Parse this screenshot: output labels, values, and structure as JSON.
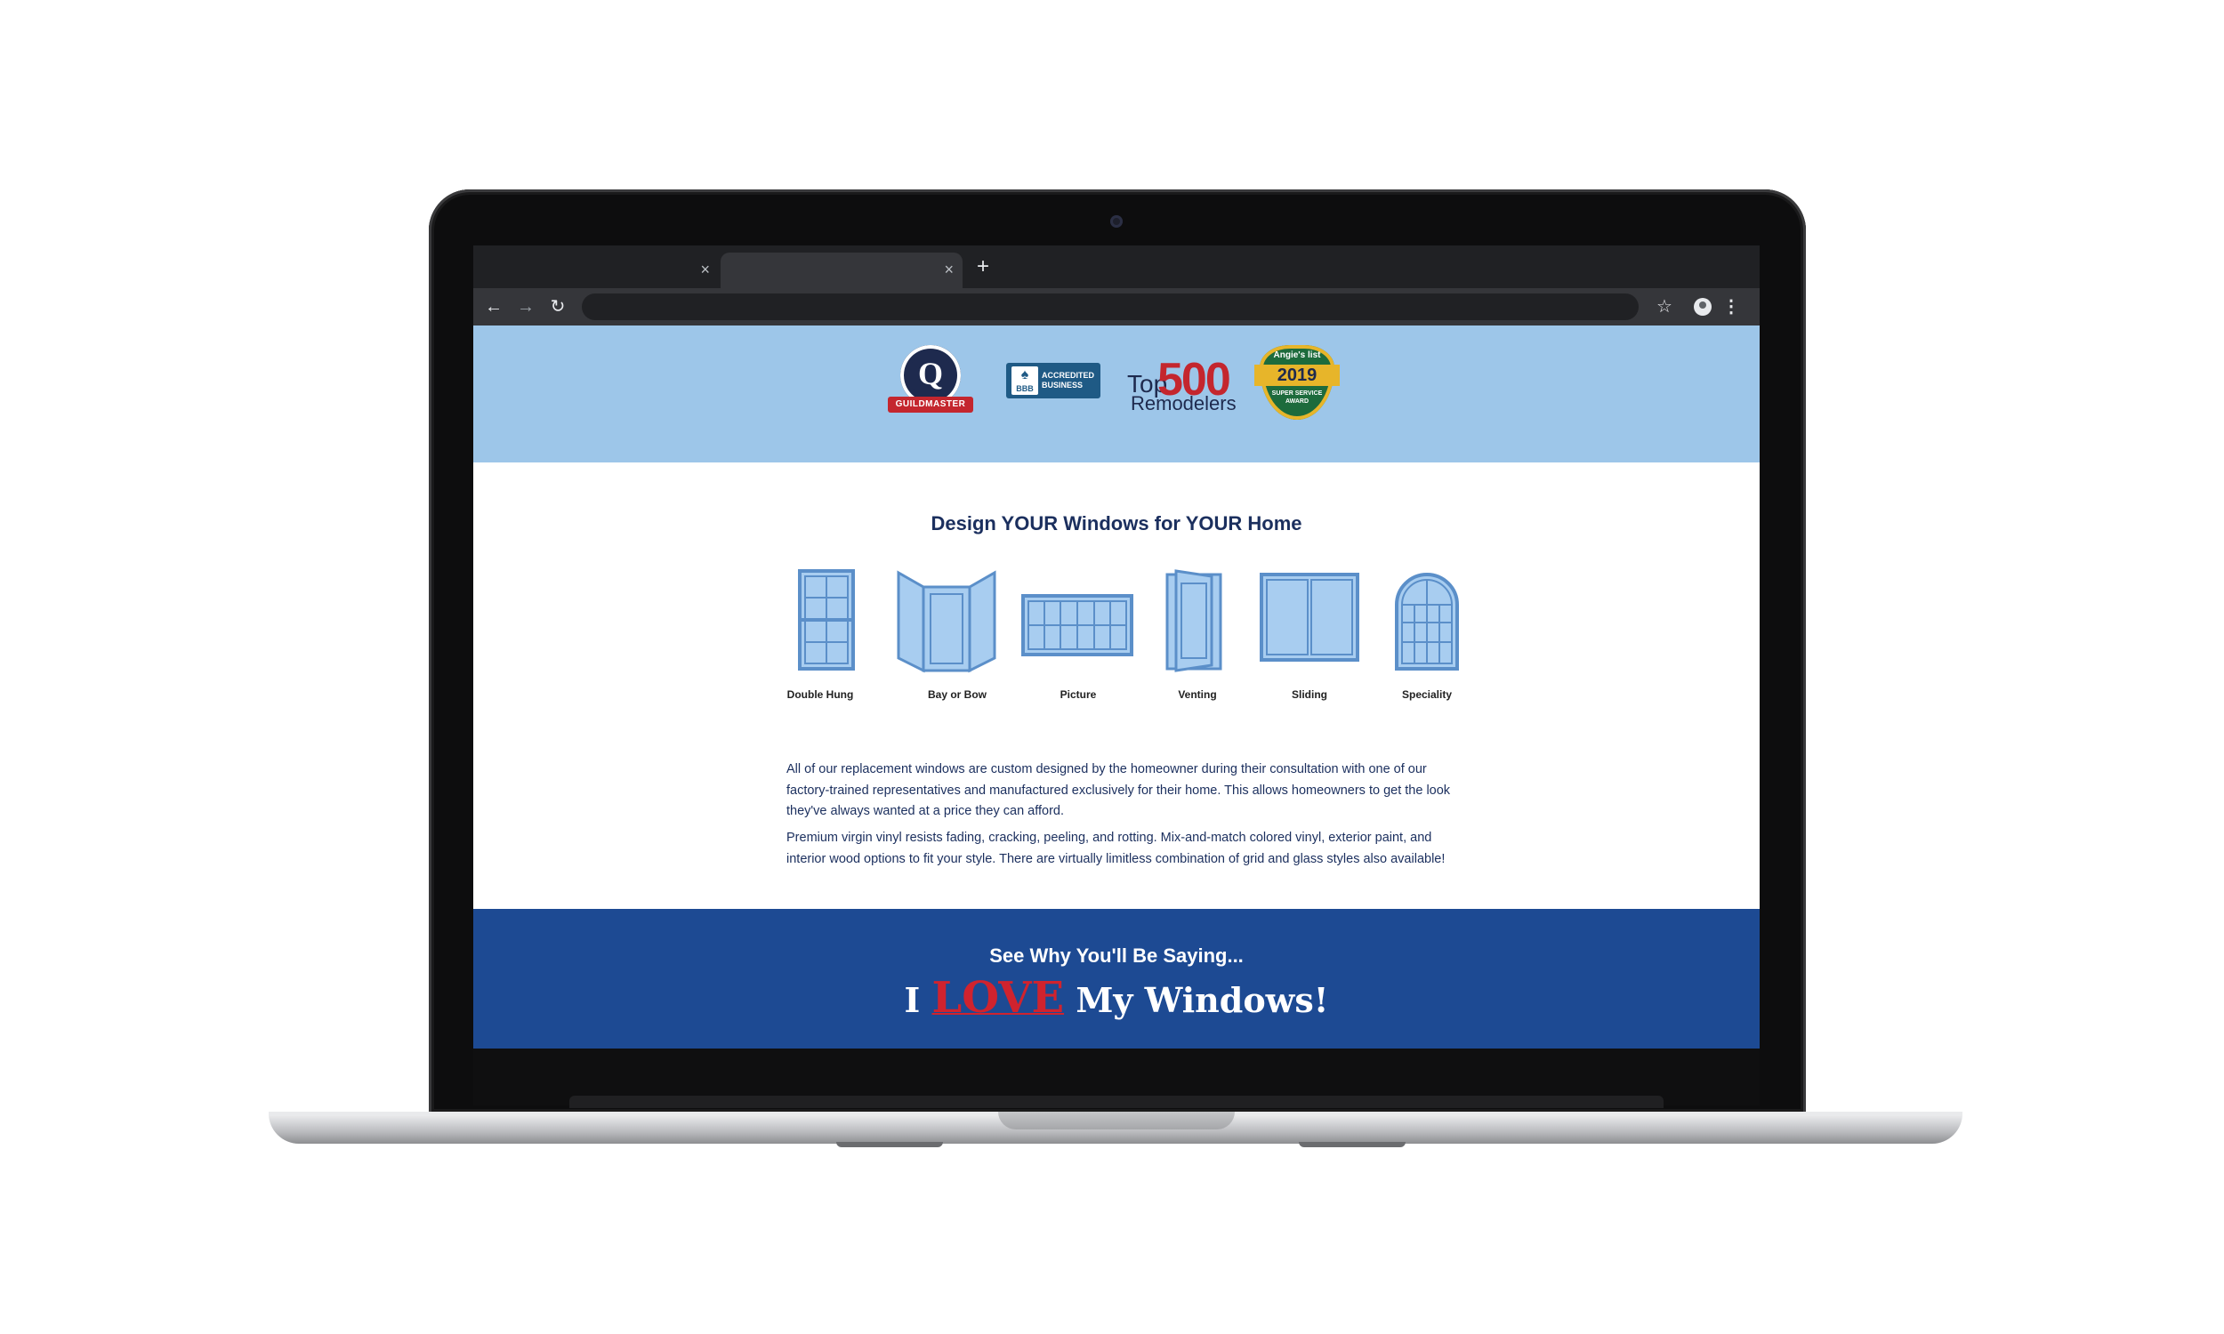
{
  "browser": {
    "tab_close_glyph": "×",
    "new_tab_glyph": "+",
    "back_glyph": "←",
    "forward_glyph": "→",
    "reload_glyph": "↻",
    "star_glyph": "☆",
    "menu_glyph": "⋮"
  },
  "badges": {
    "guildmaster": {
      "letter": "Q",
      "ribbon": "GUILDMASTER"
    },
    "bbb": {
      "mark": "BBB",
      "line1": "ACCREDITED",
      "line2": "BUSINESS"
    },
    "top500": {
      "top": "Top",
      "num": "500",
      "bottom": "Remodelers"
    },
    "angies": {
      "name": "Angie's list",
      "year": "2019",
      "line1": "SUPER SERVICE",
      "line2": "AWARD"
    }
  },
  "design": {
    "title": "Design YOUR Windows for YOUR Home",
    "windows": [
      {
        "label": "Double Hung",
        "icon": "double-hung-window-icon"
      },
      {
        "label": "Bay or Bow",
        "icon": "bay-window-icon"
      },
      {
        "label": "Picture",
        "icon": "picture-window-icon"
      },
      {
        "label": "Venting",
        "icon": "venting-window-icon"
      },
      {
        "label": "Sliding",
        "icon": "sliding-window-icon"
      },
      {
        "label": "Speciality",
        "icon": "arched-window-icon"
      }
    ],
    "paragraph1": "All of our replacement windows are custom designed by the homeowner during their consultation with one of our factory-trained representatives and manufactured exclusively for their home. This allows homeowners to get the look they've always wanted at a price they can afford.",
    "paragraph2": "Premium virgin vinyl resists fading, cracking, peeling, and rotting. Mix-and-match colored vinyl, exterior paint, and interior wood options to fit your style. There are virtually limitless combination of grid and glass styles also available!"
  },
  "cta": {
    "heading": "See Why You'll Be Saying...",
    "i": "I",
    "love": "LOVE",
    "rest": "My Windows!"
  },
  "colors": {
    "badge_band": "#9dc6e9",
    "navy_text": "#1b2f5e",
    "cta_band": "#1d4a93",
    "love_red": "#d0232e",
    "window_glass": "#a8cdf0",
    "window_frame": "#5b8fc9"
  }
}
